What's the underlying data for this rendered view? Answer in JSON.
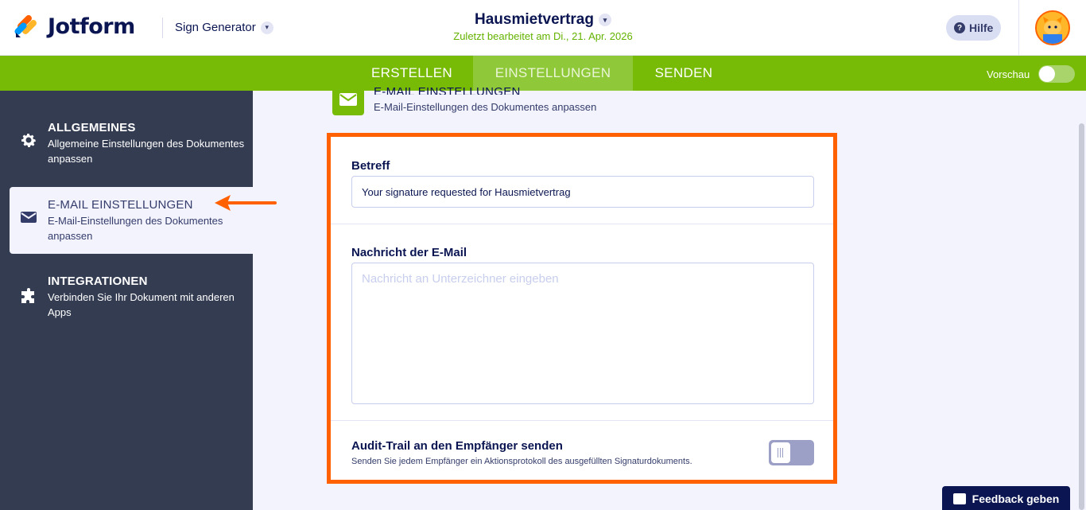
{
  "header": {
    "brand": "Jotform",
    "app_name": "Sign Generator",
    "doc_title": "Hausmietvertrag",
    "doc_subtitle": "Zuletzt bearbeitet am Di., 21. Apr. 2026",
    "help_label": "Hilfe"
  },
  "nav": {
    "tabs": [
      {
        "label": "ERSTELLEN",
        "active": false
      },
      {
        "label": "EINSTELLUNGEN",
        "active": true
      },
      {
        "label": "SENDEN",
        "active": false
      }
    ],
    "preview_label": "Vorschau"
  },
  "sidebar": {
    "items": [
      {
        "title": "ALLGEMEINES",
        "desc": "Allgemeine Einstellungen des Dokumentes anpassen",
        "icon": "gear-icon"
      },
      {
        "title": "E-MAIL EINSTELLUNGEN",
        "desc": "E-Mail-Einstellungen des Dokumentes anpassen",
        "icon": "envelope-icon",
        "active": true
      },
      {
        "title": "INTEGRATIONEN",
        "desc": "Verbinden Sie Ihr Dokument mit anderen Apps",
        "icon": "puzzle-icon"
      }
    ]
  },
  "section": {
    "title": "E-MAIL EINSTELLUNGEN",
    "desc": "E-Mail-Einstellungen des Dokumentes anpassen"
  },
  "form": {
    "subject_label": "Betreff",
    "subject_value": "Your signature requested for Hausmietvertrag",
    "message_label": "Nachricht der E-Mail",
    "message_placeholder": "Nachricht an Unterzeichner eingeben",
    "audit_title": "Audit-Trail an den Empfänger senden",
    "audit_desc": "Senden Sie jedem Empfänger ein Aktionsprotokoll des ausgefüllten Signaturdokuments.",
    "audit_enabled": false
  },
  "feedback_label": "Feedback geben",
  "colors": {
    "accent_green": "#78bb07",
    "highlight_orange": "#ff6100",
    "sidebar_bg": "#343c52",
    "navy": "#0a1551"
  }
}
